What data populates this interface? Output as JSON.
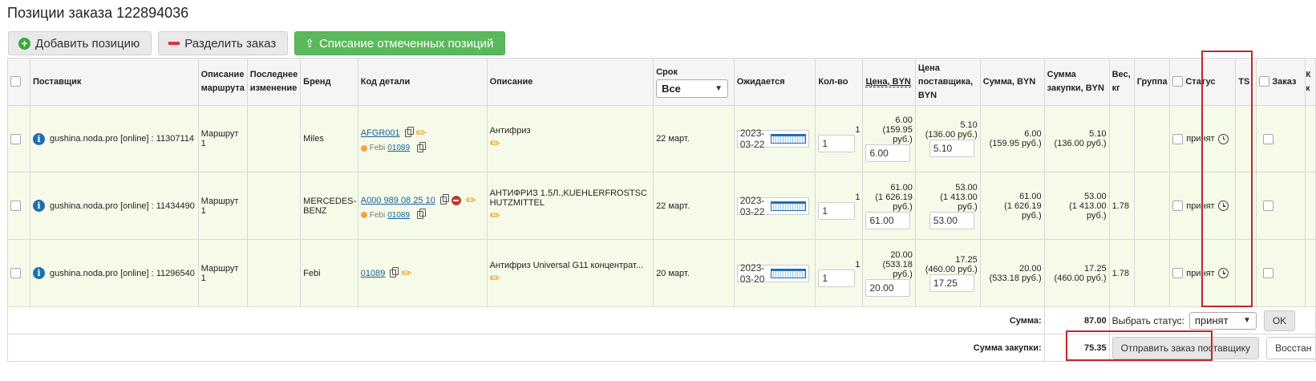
{
  "page": {
    "title": "Позиции заказа 122894036"
  },
  "toolbar": {
    "add_label": "Добавить позицию",
    "split_label": "Разделить заказ",
    "writeoff_label": "Списание отмеченных позиций"
  },
  "headers": {
    "supplier": "Поставщик",
    "route_desc": "Описание маршрута",
    "last_change": "Последнее изменение",
    "brand": "Бренд",
    "part_code": "Код детали",
    "description": "Описание",
    "term": "Срок",
    "term_select": "Все",
    "expected": "Ожидается",
    "qty": "Кол-во",
    "price": "Цена, BYN",
    "supplier_price": "Цена поставщика, BYN",
    "sum": "Сумма, BYN",
    "purchase_sum": "Сумма закупки, BYN",
    "weight": "Вес, кг",
    "group": "Группа",
    "status": "Статус",
    "ts": "TS",
    "order": "Заказ",
    "extra": "К к"
  },
  "rows": [
    {
      "supplier": "gushina.noda.pro [online] : 11307114",
      "route": "Маршрут 1",
      "brand": "Miles",
      "code": "AFGR001",
      "sub_brand": "Febi",
      "sub_code": "01089",
      "description": "Антифриз",
      "term": "22 март.",
      "expected": "2023-03-22",
      "qty_label": "1",
      "qty_value": "1",
      "price_main": "6.00",
      "price_rub": "(159.95 руб.)",
      "price_input": "6.00",
      "sup_price_main": "5.10",
      "sup_price_rub": "(136.00 руб.)",
      "sup_price_input": "5.10",
      "sum_main": "6.00",
      "sum_rub": "(159.95 руб.)",
      "purchase_main": "5.10",
      "purchase_rub": "(136.00 руб.)",
      "weight": "",
      "status": "принят"
    },
    {
      "supplier": "gushina.noda.pro [online] : 11434490",
      "route": "Маршрут 1",
      "brand": "MERCEDES-BENZ",
      "code": "A000 989 08 25 10",
      "sub_brand": "Febi",
      "sub_code": "01089",
      "description": "АНТИФРИЗ 1.5Л.,KUEHLERFROSTSCHUTZMITTEL",
      "term": "22 март.",
      "expected": "2023-03-22",
      "qty_label": "1",
      "qty_value": "1",
      "price_main": "61.00",
      "price_rub": "(1 626.19 руб.)",
      "price_input": "61.00",
      "sup_price_main": "53.00",
      "sup_price_rub": "(1 413.00 руб.)",
      "sup_price_input": "53.00",
      "sum_main": "61.00",
      "sum_rub": "(1 626.19 руб.)",
      "purchase_main": "53.00",
      "purchase_rub": "(1 413.00 руб.)",
      "weight": "1.78",
      "status": "принят"
    },
    {
      "supplier": "gushina.noda.pro [online] : 11296540",
      "route": "Маршрут 1",
      "brand": "Febi",
      "code": "01089",
      "sub_brand": "",
      "sub_code": "",
      "description": "Антифриз Universal G11 концентрат...",
      "term": "20 март.",
      "expected": "2023-03-20",
      "qty_label": "1",
      "qty_value": "1",
      "price_main": "20.00",
      "price_rub": "(533.18 руб.)",
      "price_input": "20.00",
      "sup_price_main": "17.25",
      "sup_price_rub": "(460.00 руб.)",
      "sup_price_input": "17.25",
      "sum_main": "20.00",
      "sum_rub": "(533.18 руб.)",
      "purchase_main": "17.25",
      "purchase_rub": "(460.00 руб.)",
      "weight": "1.78",
      "status": "принят"
    }
  ],
  "footer": {
    "sum_label": "Сумма:",
    "sum_value": "87.00",
    "choose_status_label": "Выбрать статус:",
    "status_select": "принят",
    "ok_label": "OK",
    "purchase_label": "Сумма закупки:",
    "purchase_value": "75.35",
    "send_label": "Отправить заказ поставщику",
    "restore_label": "Восстан"
  },
  "colors": {
    "accent_green": "#5cb85c",
    "row_bg": "#f6fbe9",
    "highlight": "#c0262d",
    "link": "#1a5fa0"
  }
}
